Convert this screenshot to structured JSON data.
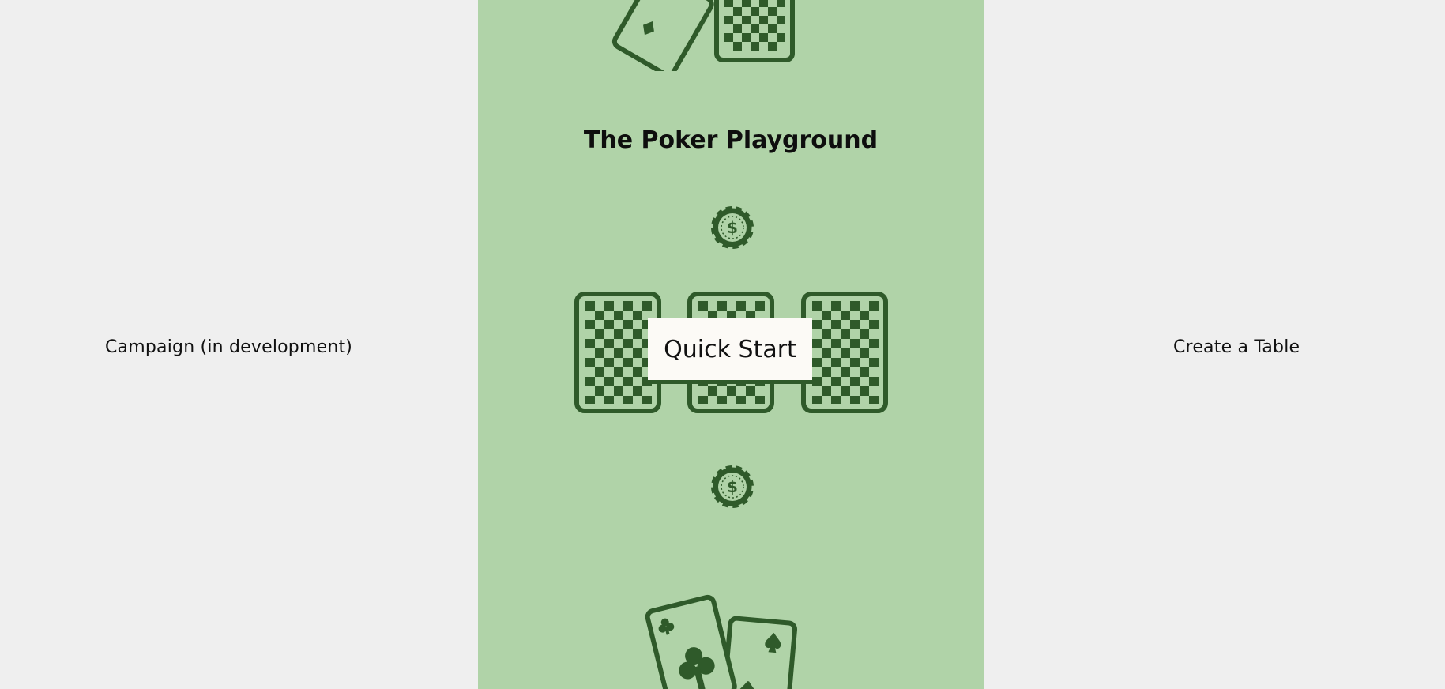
{
  "menu": {
    "left_label": "Campaign (in development)",
    "right_label": "Create a Table"
  },
  "panel": {
    "title": "The Poker Playground",
    "quick_start_label": "Quick Start",
    "colors": {
      "panel_bg": "#b0d3a8",
      "icon_green": "#2f5a2a",
      "page_bg": "#efefef",
      "button_bg": "#fcfaf6"
    }
  },
  "icons": [
    "cards-top-icon",
    "poker-chip-icon",
    "card-back-icon",
    "cards-bottom-icon"
  ]
}
